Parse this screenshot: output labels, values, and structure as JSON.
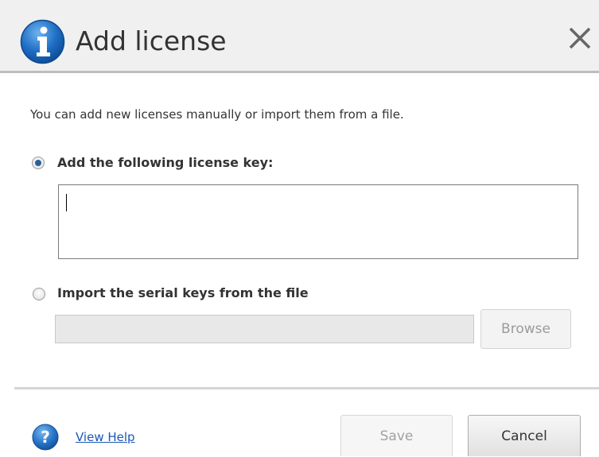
{
  "dialog": {
    "title": "Add license",
    "intro": "You can add new licenses manually or import them from a file."
  },
  "options": {
    "add_key_label": "Add the following license key:",
    "add_key_selected": true,
    "license_key_value": "",
    "import_label": "Import the serial keys from the file",
    "import_selected": false,
    "file_path_value": ""
  },
  "buttons": {
    "browse": "Browse",
    "save": "Save",
    "cancel": "Cancel"
  },
  "footer": {
    "help_link": "View Help"
  },
  "icons": {
    "header": "info-icon",
    "close": "close-icon",
    "help": "help-icon"
  },
  "colors": {
    "info_blue": "#1f6fc5",
    "link_blue": "#1a57b5",
    "radio_dot": "#2b5f9c"
  }
}
